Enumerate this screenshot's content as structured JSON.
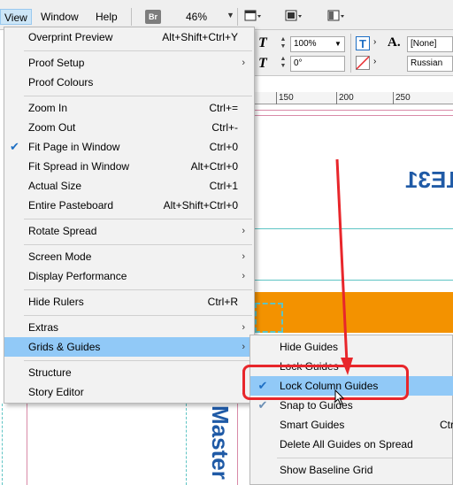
{
  "menubar": {
    "items": [
      {
        "label": "View",
        "active": true
      },
      {
        "label": "Window",
        "active": false
      },
      {
        "label": "Help",
        "active": false
      }
    ],
    "bridge_badge": "Br",
    "zoom": "46%"
  },
  "control_panel": {
    "size_value": "100%",
    "angle_value": "0°",
    "style_value": "[None]",
    "language_value": "Russian"
  },
  "ruler": {
    "labels": [
      "150",
      "200",
      "250"
    ]
  },
  "document": {
    "number_text": "#1E31",
    "vertical_text": "Master"
  },
  "view_menu": {
    "items": [
      {
        "label": "Overprint Preview",
        "shortcut": "Alt+Shift+Ctrl+Y"
      },
      {
        "label": "Proof Setup",
        "submenu": true
      },
      {
        "label": "Proof Colours"
      },
      {
        "label": "Zoom In",
        "shortcut": "Ctrl+="
      },
      {
        "label": "Zoom Out",
        "shortcut": "Ctrl+-"
      },
      {
        "label": "Fit Page in Window",
        "shortcut": "Ctrl+0",
        "checked": true
      },
      {
        "label": "Fit Spread in Window",
        "shortcut": "Alt+Ctrl+0"
      },
      {
        "label": "Actual Size",
        "shortcut": "Ctrl+1"
      },
      {
        "label": "Entire Pasteboard",
        "shortcut": "Alt+Shift+Ctrl+0"
      },
      {
        "label": "Rotate Spread",
        "submenu": true
      },
      {
        "label": "Screen Mode",
        "submenu": true
      },
      {
        "label": "Display Performance",
        "submenu": true
      },
      {
        "label": "Hide Rulers",
        "shortcut": "Ctrl+R"
      },
      {
        "label": "Extras",
        "submenu": true
      },
      {
        "label": "Grids & Guides",
        "submenu": true,
        "highlighted": true
      },
      {
        "label": "Structure",
        "submenu": true
      },
      {
        "label": "Story Editor",
        "submenu": true
      }
    ]
  },
  "guides_submenu": {
    "items": [
      {
        "label": "Hide Guides"
      },
      {
        "label": "Lock Guides"
      },
      {
        "label": "Lock Column Guides",
        "checked": true,
        "highlighted": true
      },
      {
        "label": "Snap to Guides",
        "checked": true
      },
      {
        "label": "Smart Guides",
        "shortcut": "Ctr"
      },
      {
        "label": "Delete All Guides on Spread"
      },
      {
        "label": "Show Baseline Grid"
      }
    ]
  },
  "colors": {
    "highlight": "#91c9f7",
    "annotation_red": "#e8262b",
    "orange_band": "#f39200",
    "doc_blue": "#1f5aa6"
  }
}
